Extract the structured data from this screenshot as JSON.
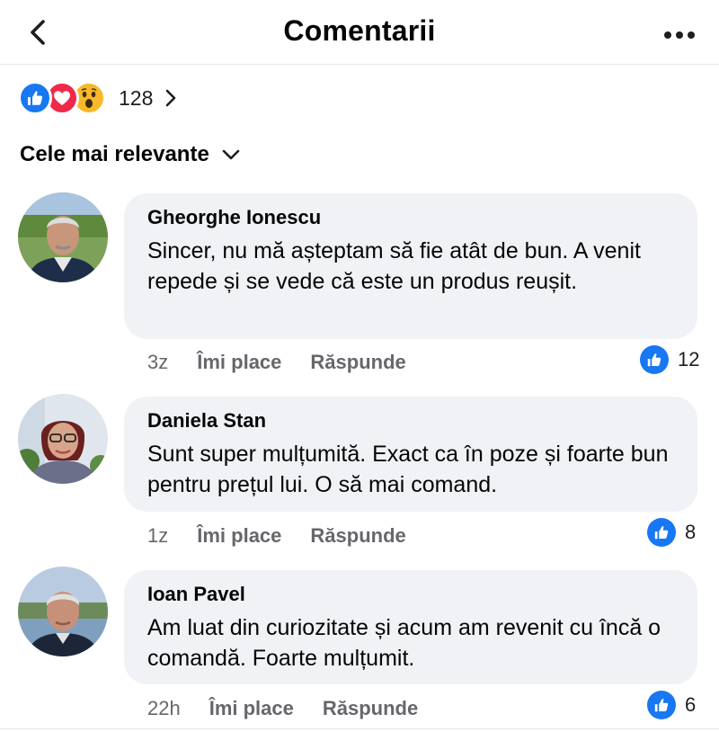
{
  "header": {
    "title": "Comentarii",
    "back_icon": "chevron-left-icon",
    "more_icon": "more-horizontal-icon"
  },
  "reactions": {
    "types": [
      "like",
      "love",
      "wow"
    ],
    "count": "128"
  },
  "sort": {
    "label": "Cele mai relevante"
  },
  "comments": [
    {
      "author": "Gheorghe Ionescu",
      "text": "Sincer, nu mă așteptam să fie atât de bun. A venit repede și se vede că este un produs reușit.",
      "time": "3z",
      "like_label": "Îmi place",
      "reply_label": "Răspunde",
      "likes": "12"
    },
    {
      "author": "Daniela Stan",
      "text": "Sunt super mulțumită. Exact ca în poze și foarte bun pentru prețul lui. O să mai comand.",
      "time": "1z",
      "like_label": "Îmi place",
      "reply_label": "Răspunde",
      "likes": "8"
    },
    {
      "author": "Ioan Pavel",
      "text": "Am luat din curiozitate și acum am revenit cu încă o comandă. Foarte mulțumit.",
      "time": "22h",
      "like_label": "Îmi place",
      "reply_label": "Răspunde",
      "likes": "6"
    }
  ],
  "colors": {
    "accent": "#1877f2",
    "love": "#f02849",
    "wow": "#f7b928",
    "bubble": "#f0f2f5",
    "secondary_text": "#65676b"
  }
}
